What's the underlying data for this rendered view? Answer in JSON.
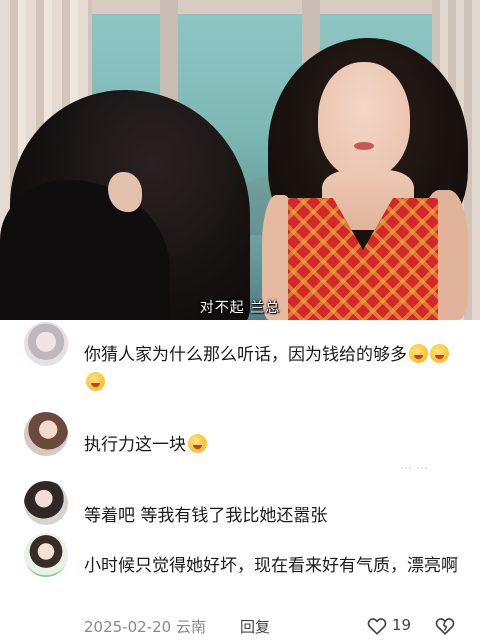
{
  "video": {
    "subtitle": "对不起 兰总"
  },
  "comments": [
    {
      "text": "你猜人家为什么那么听话，因为钱给的够多",
      "emoji_count": 3
    },
    {
      "text": "执行力这一块",
      "emoji_count": 1
    },
    {
      "text": "等着吧  等我有钱了我比她还嚣张",
      "emoji_count": 0
    },
    {
      "text": "小时候只觉得她好坏，现在看来好有气质，漂亮啊",
      "emoji_count": 0
    }
  ],
  "meta": {
    "date_location": "2025-02-20 云南",
    "reply_label": "回复",
    "like_count": "19"
  },
  "colors": {
    "dress": "#d5262c",
    "emoji": "#f7c12f",
    "meta_text": "#8a8a8a"
  }
}
